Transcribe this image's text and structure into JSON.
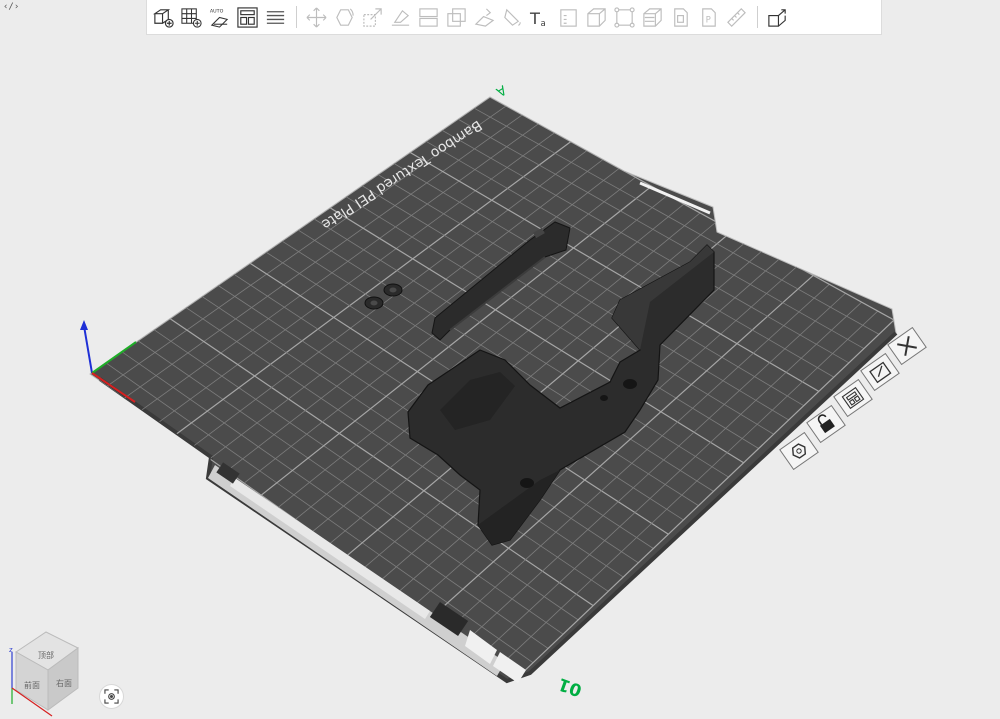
{
  "window": {
    "corner_glyph": "‹/›"
  },
  "toolbar": {
    "tools": [
      {
        "id": "add-object",
        "icon": "add-cube-icon"
      },
      {
        "id": "add-plate",
        "icon": "add-plate-icon"
      },
      {
        "id": "auto-orient",
        "icon": "auto-orient-icon",
        "label": "AUTO"
      },
      {
        "id": "arrange",
        "icon": "arrange-icon"
      },
      {
        "id": "layers",
        "icon": "layers-icon"
      },
      {
        "id": "move",
        "icon": "move-icon"
      },
      {
        "id": "rotate",
        "icon": "rotate-icon"
      },
      {
        "id": "scale",
        "icon": "scale-icon"
      },
      {
        "id": "lay-on-face",
        "icon": "lay-on-face-icon"
      },
      {
        "id": "split",
        "icon": "split-icon"
      },
      {
        "id": "cut",
        "icon": "cut-icon"
      },
      {
        "id": "support-paint",
        "icon": "support-paint-icon"
      },
      {
        "id": "color-paint",
        "icon": "color-paint-icon"
      },
      {
        "id": "text",
        "icon": "text-icon",
        "label": "Ta"
      },
      {
        "id": "variable-height",
        "icon": "variable-height-icon"
      },
      {
        "id": "boolean",
        "icon": "boolean-icon"
      },
      {
        "id": "measure",
        "icon": "measure-icon"
      },
      {
        "id": "assembly",
        "icon": "assembly-icon"
      },
      {
        "id": "slice-view",
        "icon": "slice-view-icon"
      },
      {
        "id": "plate-preview",
        "icon": "plate-preview-icon"
      },
      {
        "id": "plate-p",
        "icon": "plate-p-icon",
        "label": "P"
      },
      {
        "id": "ruler",
        "icon": "ruler-icon"
      },
      {
        "id": "explode",
        "icon": "explode-icon"
      }
    ]
  },
  "bed": {
    "title": "Bamboo Textured PEI Plate",
    "label_a": "A",
    "plate_number": "01",
    "side_buttons": [
      {
        "id": "close-plate",
        "icon": "close-x-icon"
      },
      {
        "id": "edit-plate",
        "icon": "edit-plate-icon"
      },
      {
        "id": "arrange-plate",
        "icon": "arrange-plate-icon"
      },
      {
        "id": "lock-plate",
        "icon": "lock-plate-icon"
      },
      {
        "id": "plate-settings",
        "icon": "hex-settings-icon"
      }
    ]
  },
  "view_cube": {
    "faces": [
      "顶部",
      "前面",
      "右面"
    ]
  },
  "colors": {
    "bed": "#4a4a4a",
    "grid": "#8c8c8c",
    "model": "#2d2d2d",
    "accent": "#00ae42"
  }
}
